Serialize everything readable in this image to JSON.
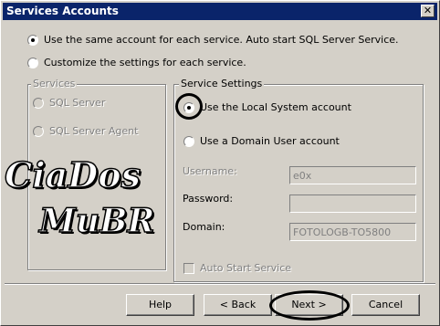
{
  "window": {
    "title": "Services Accounts",
    "close_glyph": "✕"
  },
  "top_options": [
    {
      "label": "Use the same account for each service. Auto start SQL Server Service.",
      "checked": true
    },
    {
      "label": "Customize the settings for each service.",
      "checked": false
    }
  ],
  "services_group": {
    "title": "Services",
    "items": [
      {
        "label": "SQL Server",
        "enabled": false
      },
      {
        "label": "SQL Server Agent",
        "enabled": false
      }
    ]
  },
  "settings_group": {
    "title": "Service Settings",
    "local_system": {
      "label": "Use the Local System account",
      "checked": true
    },
    "domain_user": {
      "label": "Use a Domain User account",
      "checked": false
    },
    "username": {
      "label": "Username:",
      "value": "e0x"
    },
    "password": {
      "label": "Password:",
      "value": ""
    },
    "domain": {
      "label": "Domain:",
      "value": "FOTOLOGB-TO5800"
    },
    "auto_start": {
      "label": "Auto Start Service",
      "checked": false,
      "enabled": false
    }
  },
  "buttons": {
    "help": "Help",
    "back": "< Back",
    "next": "Next >",
    "cancel": "Cancel"
  },
  "watermark": {
    "line1": "CiaDos",
    "line2": "MuBR"
  }
}
